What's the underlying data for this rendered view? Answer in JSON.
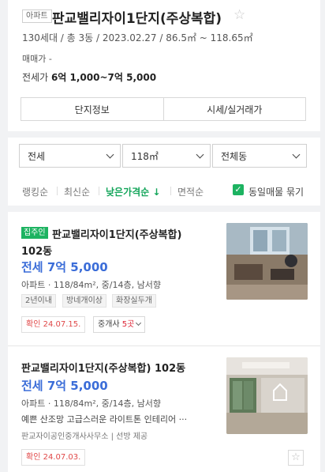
{
  "complex": {
    "type_tag": "아파트",
    "name": "판교밸리자이1단지(주상복합)",
    "meta": "130세대 / 총 3동 / 2023.02.27 / 86.5㎡ ~ 118.65㎡",
    "sale_label": "매매가",
    "sale_value": "-",
    "lease_label": "전세가",
    "lease_value": "6억 1,000~7억 5,000",
    "buttons": [
      "단지정보",
      "시세/실거래가"
    ]
  },
  "filters": {
    "trade_type": "전세",
    "area": "118㎡",
    "building": "전체동"
  },
  "sort": {
    "options": [
      "랭킹순",
      "최신순",
      "낮은가격순",
      "면적순"
    ],
    "active_suffix": "↓",
    "group_same_label": "동일매물 묶기"
  },
  "listings": [
    {
      "badge": "집주인",
      "title": "판교밸리자이1단지(주상복합)",
      "building": "102동",
      "price": "전세 7억 5,000",
      "spec": "아파트 · 118/84m², 중/14층, 남서향",
      "tags": [
        "2년이내",
        "방네개이상",
        "화장실두개"
      ],
      "confirm": "확인 24.07.15.",
      "agent_prefix": "중개사",
      "agent_count": "5곳"
    },
    {
      "title": "판교밸리자이1단지(주상복합) 102동",
      "price": "전세 7억 5,000",
      "spec": "아파트 · 118/84m², 중/14층, 남서향",
      "desc": "예쁜 산조망 고급스러운 라이트톤 인테리어 ···",
      "agent_line": "판교자이공인중개사사무소 | 선방 제공",
      "confirm": "확인 24.07.03."
    }
  ],
  "icons": {
    "star": "star-outline-icon",
    "check": "checkbox-checked-icon",
    "chevron": "chevron-down-icon"
  },
  "colors": {
    "accent_green": "#1db361",
    "price_blue": "#3b6dd8",
    "confirm_red": "#e04848"
  }
}
